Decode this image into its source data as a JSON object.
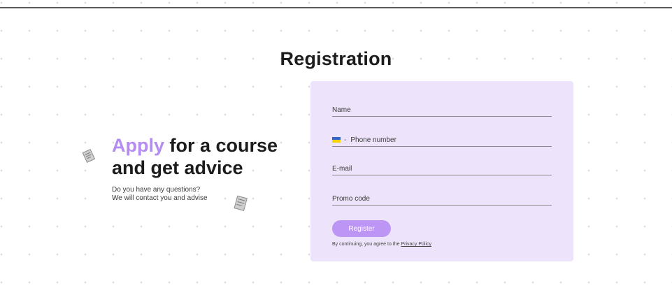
{
  "page": {
    "title": "Registration"
  },
  "promo": {
    "headline_accent": "Apply",
    "headline_rest_line1": " for a course",
    "headline_line2": "and get advice",
    "subtext_line1": "Do you have any questions?",
    "subtext_line2": "We will contact you and advise"
  },
  "form": {
    "name_placeholder": "Name",
    "phone_placeholder": "Phone number",
    "phone_prefix": "-",
    "email_placeholder": "E-mail",
    "promo_placeholder": "Promo code",
    "submit_label": "Register",
    "legal_text": "By continuing, you agree to the ",
    "legal_link": "Privacy Policy"
  },
  "icons": {
    "phone_flag": "ukraine-flag-icon",
    "decor": "document-icon"
  },
  "colors": {
    "accent": "#b58cf2",
    "card_bg": "#ede4fb",
    "button_bg": "#bd95f5"
  }
}
